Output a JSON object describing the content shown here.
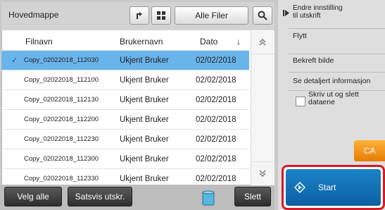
{
  "header": {
    "folder_title": "Hovedmappe",
    "filter_label": "Alle Filer"
  },
  "columns": {
    "filename": "Filnavn",
    "user": "Brukernavn",
    "date": "Dato",
    "sort_indicator": "↓"
  },
  "files": [
    {
      "name": "Copy_02022018_112030",
      "user": "Ukjent Bruker",
      "date": "02/02/2018",
      "selected": true
    },
    {
      "name": "Copy_02022018_112100",
      "user": "Ukjent Bruker",
      "date": "02/02/2018",
      "selected": false
    },
    {
      "name": "Copy_02022018_112130",
      "user": "Ukjent Bruker",
      "date": "02/02/2018",
      "selected": false
    },
    {
      "name": "Copy_02022018_112200",
      "user": "Ukjent Bruker",
      "date": "02/02/2018",
      "selected": false
    },
    {
      "name": "Copy_02022018_112230",
      "user": "Ukjent Bruker",
      "date": "02/02/2018",
      "selected": false
    },
    {
      "name": "Copy_02022018_112300",
      "user": "Ukjent Bruker",
      "date": "02/02/2018",
      "selected": false
    },
    {
      "name": "Copy_02022018_112330",
      "user": "Ukjent Bruker",
      "date": "02/02/2018",
      "selected": false
    }
  ],
  "bottom": {
    "select_all": "Velg alle",
    "batch_print": "Satsvis utskr.",
    "delete": "Slett"
  },
  "sidebar": {
    "change_settings_line1": "Endre innstilling",
    "change_settings_line2": "til utskrift",
    "move": "Flytt",
    "confirm_image": "Bekreft bilde",
    "details": "Se detaljert informasjon",
    "print_delete_line1": "Skriv ut og slett",
    "print_delete_line2": "dataene",
    "ca": "CA",
    "start": "Start"
  },
  "colors": {
    "selection": "#69b4eb",
    "start": "#0d60a3",
    "start_highlight": "#d41a22",
    "ca": "#e77b05"
  }
}
